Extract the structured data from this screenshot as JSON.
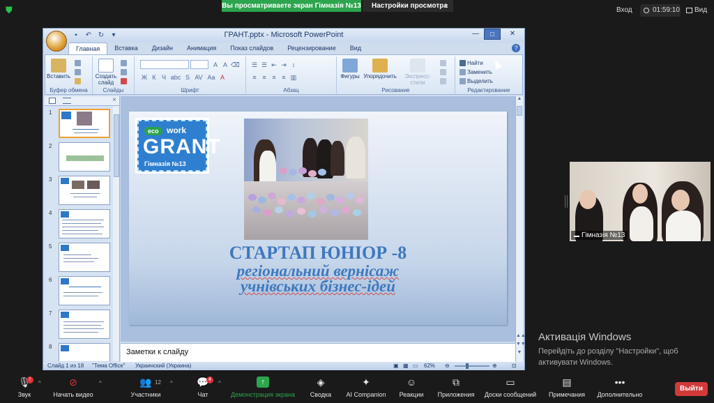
{
  "topbar": {
    "share_banner": "Вы просматриваете экран Гімназія №13",
    "view_settings": "Настройки просмотра",
    "enter": "Вход",
    "timer": "01:59:10",
    "view": "Вид"
  },
  "ppt": {
    "window_title": "ГРАНТ.pptx - Microsoft PowerPoint",
    "tabs": [
      "Главная",
      "Вставка",
      "Дизайн",
      "Анимация",
      "Показ слайдов",
      "Рецензирование",
      "Вид"
    ],
    "ribbon": {
      "paste": "Вставить",
      "clipboard_group": "Буфер обмена",
      "new_slide": "Создать слайд",
      "slides_group": "Слайды",
      "font_group": "Шрифт",
      "paragraph_group": "Абзац",
      "shapes": "Фигуры",
      "arrange": "Упорядочить",
      "quick_styles": "Экспресс-стили",
      "drawing_group": "Рисование",
      "find": "Найти",
      "replace": "Заменить",
      "select": "Выделить",
      "editing_group": "Редактирование",
      "font_size_a": "A",
      "bold": "Ж",
      "italic": "К",
      "underline": "Ч",
      "strike": "abc",
      "spacing": "AV",
      "case": "Aa"
    },
    "thumbnails": [
      "1",
      "2",
      "3",
      "4",
      "5",
      "6",
      "7",
      "8"
    ],
    "slide": {
      "logo_eco": "eco",
      "logo_work": "work",
      "logo_grant": "GRANT",
      "logo_gym": "Гімназія №13",
      "title": "СТАРТАП ЮНІОР -8",
      "subtitle_line1": "регіональний  вернісаж",
      "subtitle_line2": "учнівських бізнес-ідей"
    },
    "notes_placeholder": "Заметки к слайду",
    "status": {
      "slide_of": "Слайд 1 из 18",
      "theme": "\"Тема Office\"",
      "language": "Украинский (Украина)",
      "zoom": "62%"
    }
  },
  "camera": {
    "label": "Гімназія №13"
  },
  "activation": {
    "title": "Активація Windows",
    "line1": "Перейдіть до розділу \"Настройки\", щоб",
    "line2": "активувати Windows."
  },
  "toolbar": {
    "audio": "Звук",
    "video": "Начать видео",
    "participants": "Участники",
    "participants_count": "12",
    "chat": "Чат",
    "chat_badge": "4",
    "audio_badge": "!",
    "share": "Демонстрация экрана",
    "summary": "Сводка",
    "ai": "AI Companion",
    "reactions": "Реакции",
    "apps": "Приложения",
    "whiteboards": "Доски сообщений",
    "notes": "Примечания",
    "more": "Дополнительно",
    "exit": "Выйти"
  },
  "colors": {
    "zoom_green": "#2da44e",
    "exit_red": "#d23a3a",
    "slide_title_blue": "#3f78bd",
    "logo_blue": "#2e7fd0"
  }
}
